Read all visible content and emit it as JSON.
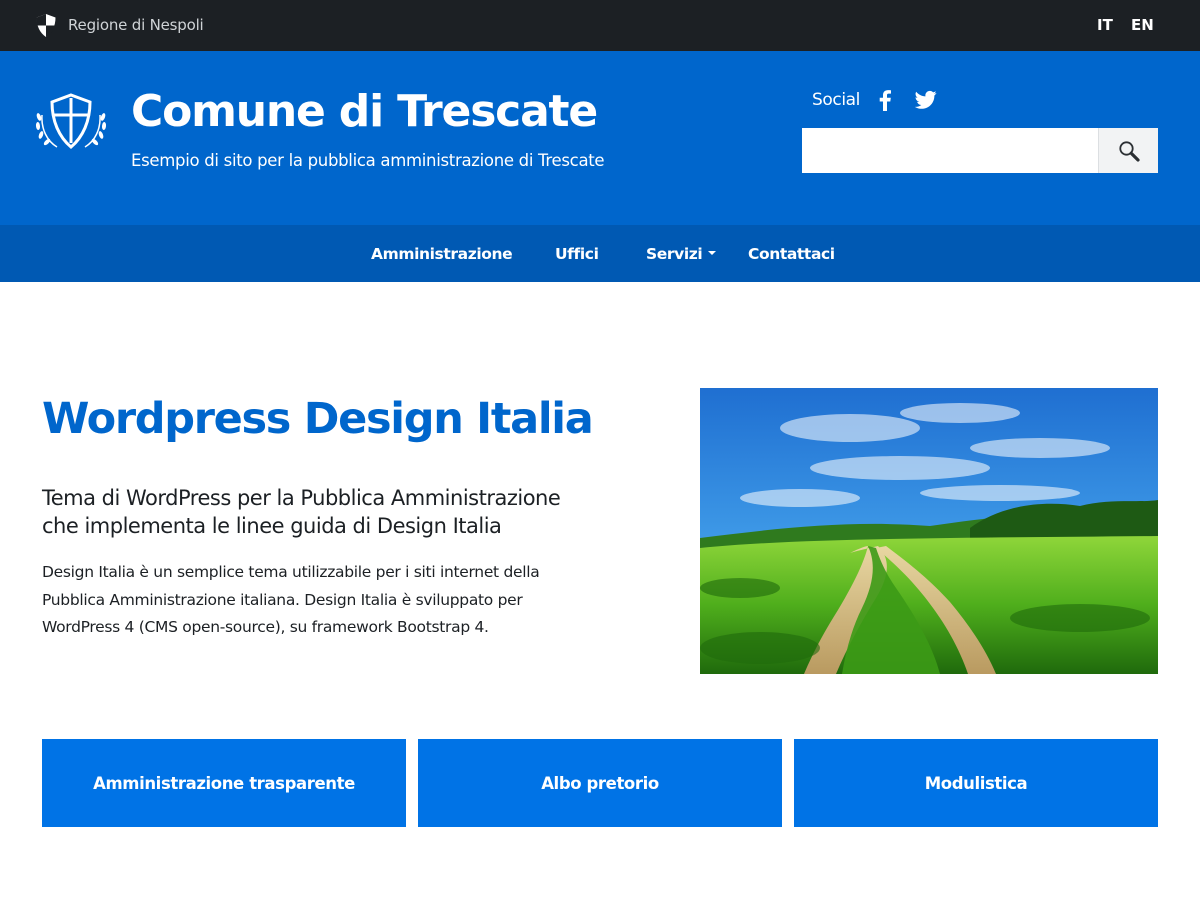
{
  "topbar": {
    "region_name": "Regione di Nespoli",
    "region_icon": "shield-icon",
    "languages": [
      "IT",
      "EN"
    ]
  },
  "header": {
    "title": "Comune di Trescate",
    "subtitle": "Esempio di sito per la pubblica amministrazione di Trescate",
    "crest_icon": "crest-shield-laurel-icon",
    "social_label": "Social",
    "social_icons": [
      "facebook-icon",
      "twitter-icon"
    ],
    "search": {
      "value": "",
      "placeholder": "",
      "button_icon": "magnifier-icon"
    }
  },
  "nav": {
    "items": [
      {
        "label": "Amministrazione"
      },
      {
        "label": "Uffici"
      },
      {
        "label": "Servizi"
      },
      {
        "label": "Contattaci"
      }
    ]
  },
  "hero": {
    "title": "Wordpress Design Italia",
    "subtitle": "Tema di WordPress per la Pubblica Amministrazione che implementa le linee guida di Design Italia",
    "text": "Design Italia è un semplice tema utilizzabile per i siti internet della Pubblica Amministrazione italiana. Design Italia è sviluppato per WordPress 4 (CMS open-source), su framework Bootstrap 4."
  },
  "quick_links": [
    {
      "label": "Amministrazione trasparente"
    },
    {
      "label": "Albo pretorio"
    },
    {
      "label": "Modulistica"
    }
  ],
  "colors": {
    "topbar": "#1c2024",
    "header": "#0066cc",
    "navbar": "#0059b3",
    "accent": "#0066cc",
    "button": "#0073e6"
  }
}
